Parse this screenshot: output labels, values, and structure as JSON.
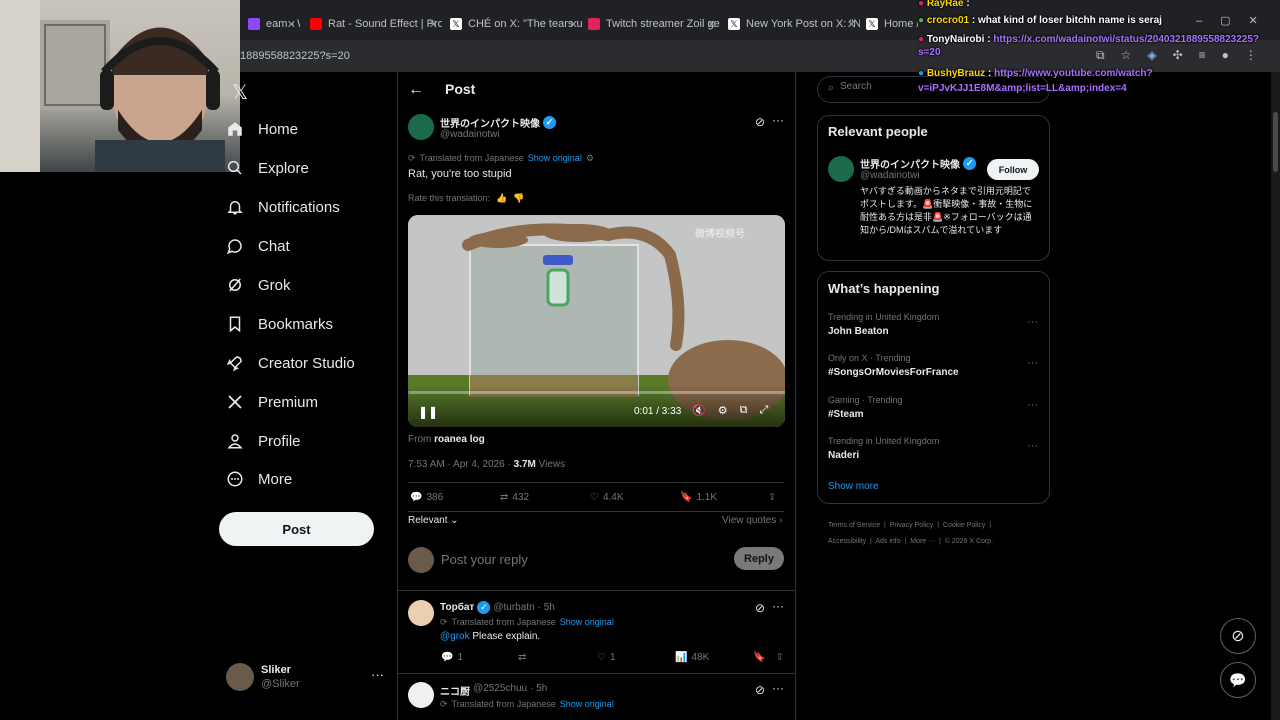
{
  "browser": {
    "tabs": [
      {
        "label": "eam - Wat",
        "color": "#9146ff"
      },
      {
        "label": "Rat - Sound Effect | ProSo",
        "color": "#ff0000"
      },
      {
        "label": "CHÉ on X: \"The tears und",
        "color": "#000000"
      },
      {
        "label": "Twitch streamer Zoil gets",
        "color": "#e0245e"
      },
      {
        "label": "New York Post on X: \"New",
        "color": "#000000"
      },
      {
        "label": "Home / X",
        "color": "#000000"
      }
    ],
    "url": "1889558823225?s=20"
  },
  "sidebar": {
    "items": [
      {
        "label": "Home",
        "icon": "home-icon"
      },
      {
        "label": "Explore",
        "icon": "search-icon"
      },
      {
        "label": "Notifications",
        "icon": "bell-icon"
      },
      {
        "label": "Chat",
        "icon": "chat-icon"
      },
      {
        "label": "Grok",
        "icon": "grok-icon"
      },
      {
        "label": "Bookmarks",
        "icon": "bookmark-icon"
      },
      {
        "label": "Creator Studio",
        "icon": "rocket-icon"
      },
      {
        "label": "Premium",
        "icon": "x-logo-icon"
      },
      {
        "label": "Profile",
        "icon": "person-icon"
      },
      {
        "label": "More",
        "icon": "more-circle-icon"
      }
    ],
    "post_button": "Post",
    "account": {
      "name": "Sliker",
      "handle": "@Sliker"
    }
  },
  "header": {
    "title": "Post"
  },
  "post": {
    "author": "世界のインパクト映像",
    "handle": "@wadainotwi",
    "translated_label": "Translated from Japanese",
    "show_original": "Show original",
    "text": "Rat, you're too stupid",
    "rate_label": "Rate this translation:",
    "video": {
      "time": "0:01 / 3:33",
      "watermark": "微博视频号",
      "progress": 0.005
    },
    "from_label": "From",
    "from_source": "roanea log",
    "timestamp": "7:53 AM · Apr 4, 2026 ·",
    "views_count": "3.7M",
    "views_label": "Views",
    "stats": {
      "replies": "386",
      "reposts": "432",
      "likes": "4.4K",
      "bookmarks": "1.1K"
    },
    "relevant_label": "Relevant",
    "view_quotes": "View quotes"
  },
  "reply_box": {
    "placeholder": "Post your reply",
    "button": "Reply"
  },
  "replies": [
    {
      "name": "Торбат",
      "handle": "@turbatn",
      "time": "· 5h",
      "translated": "Translated from Japanese",
      "show_original": "Show original",
      "mention": "@grok",
      "text": "Please explain.",
      "stats": {
        "replies": "1",
        "reposts": "",
        "likes": "1",
        "views": "48K"
      }
    },
    {
      "name": "ニコ厨",
      "handle": "@2525chuu",
      "time": "· 5h",
      "translated": "Translated from Japanese",
      "show_original": "Show original"
    }
  ],
  "search": {
    "placeholder": "Search"
  },
  "relevant_people": {
    "title": "Relevant people",
    "name": "世界のインパクト映像",
    "handle": "@wadainotwi",
    "follow": "Follow",
    "bio": "ヤバすぎる動画からネタまで引用元明記でポストします。🚨衝撃映像・事故・生物に耐性ある方は是非🚨※フォローバックは通知から/DMはスパムで溢れています"
  },
  "whats_happening": {
    "title": "What’s happening",
    "trends": [
      {
        "context": "Trending in United Kingdom",
        "topic": "John Beaton"
      },
      {
        "context": "Only on X · Trending",
        "topic": "#SongsOrMoviesForFrance"
      },
      {
        "context": "Gaming · Trending",
        "topic": "#Steam"
      },
      {
        "context": "Trending in United Kingdom",
        "topic": "Naderi"
      }
    ],
    "show_more": "Show more"
  },
  "footer": {
    "links": [
      "Terms of Service",
      "Privacy Policy",
      "Cookie Policy",
      "Accessibility",
      "Ads info",
      "More ···",
      "© 2026 X Corp."
    ]
  },
  "chat_overlay": [
    {
      "user": "RayRae",
      "message": ":",
      "color": "#ffd700"
    },
    {
      "user": "crocro01",
      "message": ": what kind of loser bitchh name is seraj",
      "color": "#ffd700"
    },
    {
      "user": "TonyNairobi",
      "message": ":",
      "link": "https://x.com/wadainotwi/status/2040321889558823225?s=20",
      "color": "#ffffff"
    },
    {
      "user": "BushyBrauz",
      "message": ":",
      "link": "https://www.youtube.com/watch?v=iPJvKJJ1E8M&amp;list=LL&amp;index=4",
      "color": "#ffd700"
    }
  ]
}
